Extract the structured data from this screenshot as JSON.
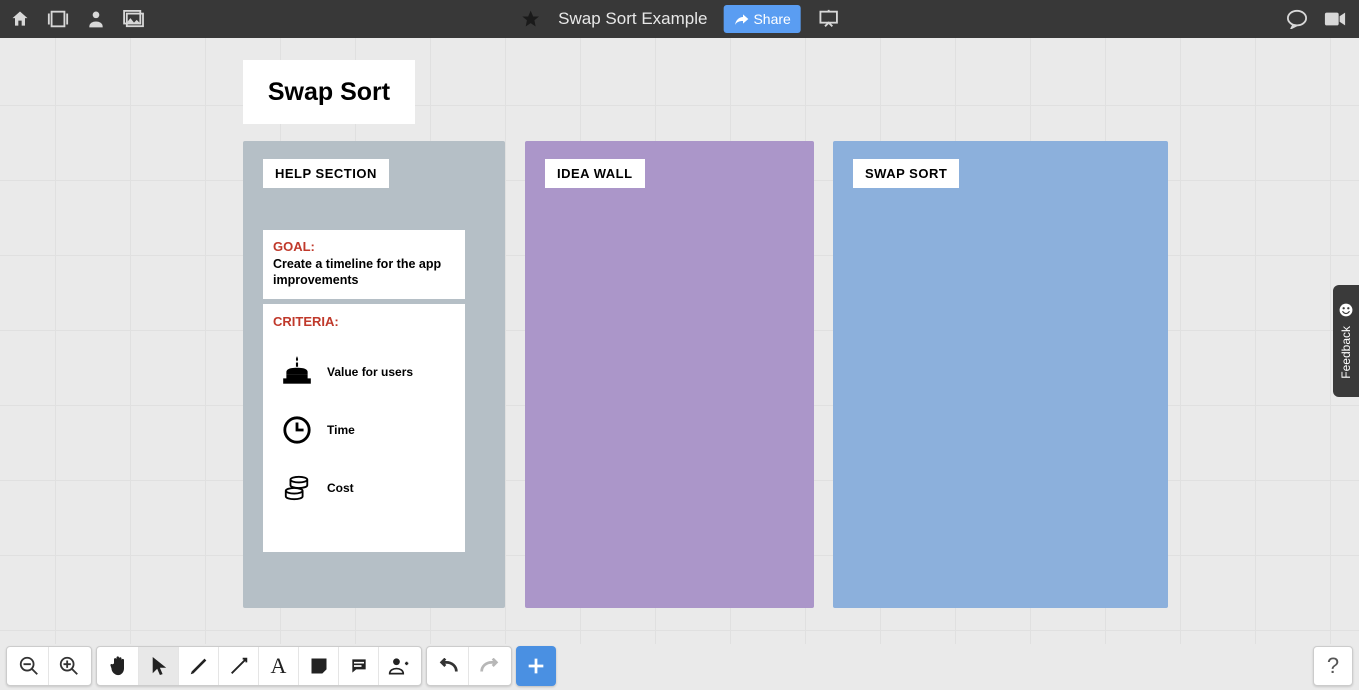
{
  "header": {
    "title": "Swap Sort Example",
    "share_label": "Share"
  },
  "board": {
    "title": "Swap Sort",
    "columns": {
      "help": {
        "label": "HELP SECTION"
      },
      "idea": {
        "label": "IDEA WALL"
      },
      "swap": {
        "label": "SWAP SORT"
      }
    },
    "goal": {
      "heading": "GOAL:",
      "text": "Create a timeline for the app improvements"
    },
    "criteria": {
      "heading": "CRITERIA:",
      "items": {
        "value": {
          "label": "Value for users"
        },
        "time": {
          "label": "Time"
        },
        "cost": {
          "label": "Cost"
        }
      }
    }
  },
  "feedback": {
    "label": "Feedback"
  },
  "help": {
    "label": "?"
  }
}
